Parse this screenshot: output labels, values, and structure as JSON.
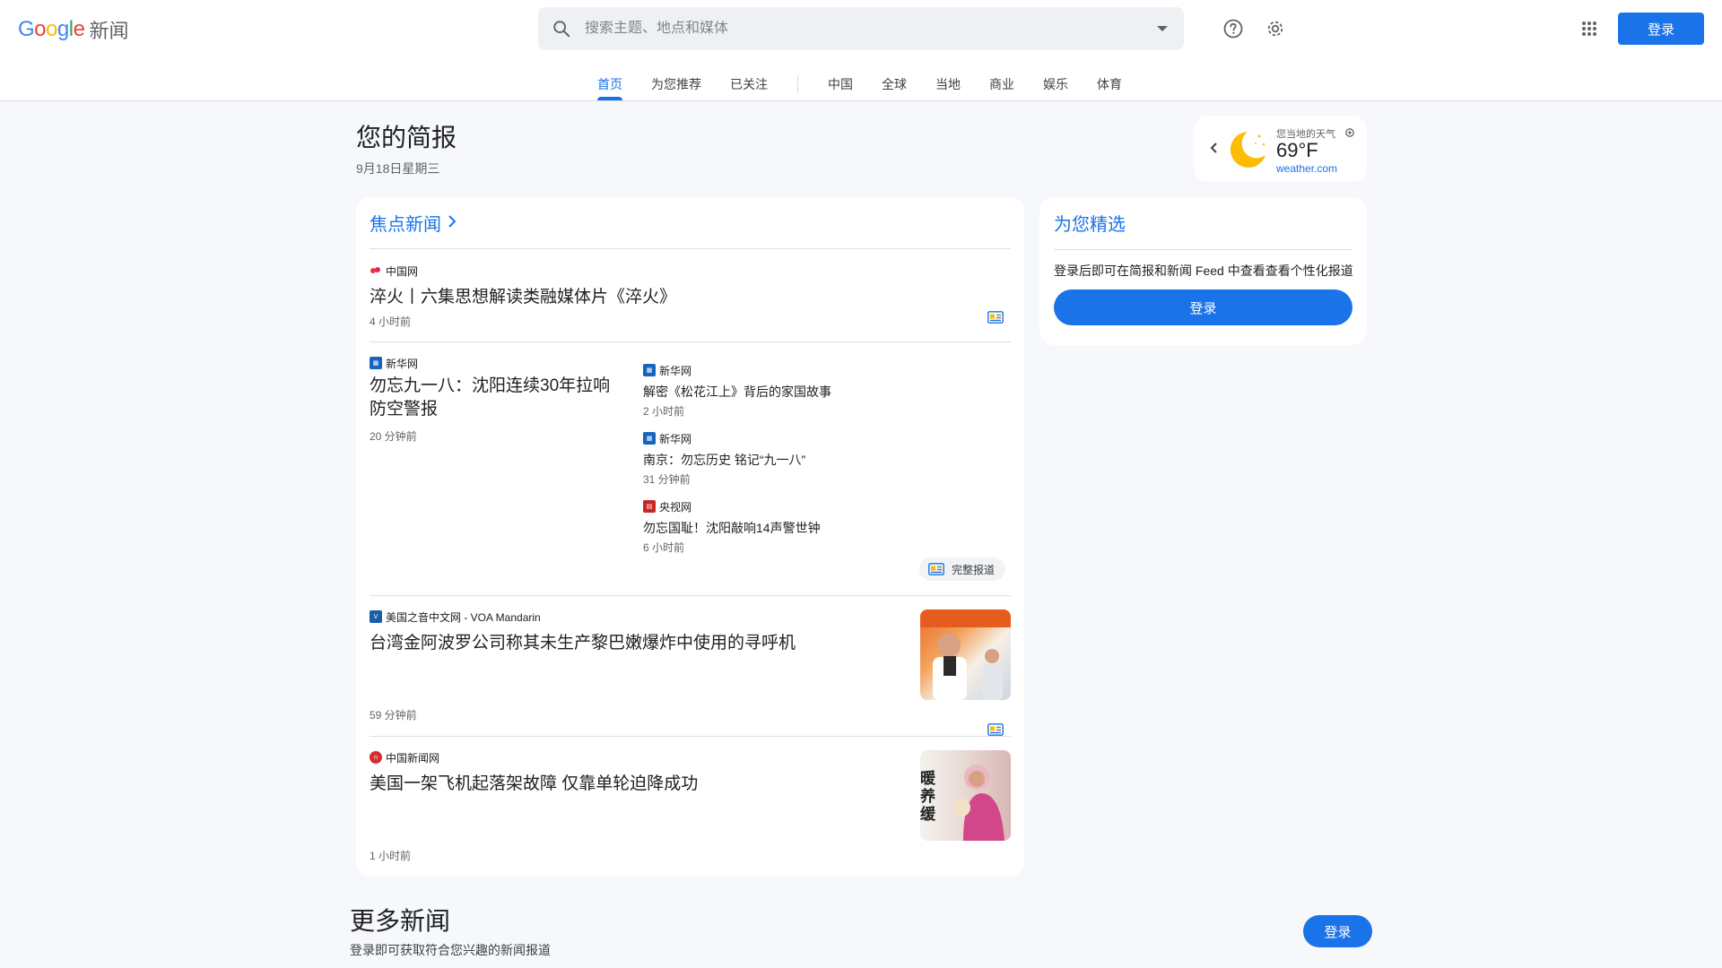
{
  "header": {
    "logo_text": "Google",
    "logo_suffix": "新闻",
    "search_placeholder": "搜索主题、地点和媒体",
    "login_label": "登录",
    "icons": [
      "search-icon",
      "dropdown-icon",
      "help-icon",
      "settings-icon",
      "apps-grid-icon"
    ]
  },
  "nav": {
    "tabs": [
      {
        "label": "首页",
        "active": true
      },
      {
        "label": "为您推荐"
      },
      {
        "label": "已关注"
      }
    ],
    "sections": [
      {
        "label": "中国"
      },
      {
        "label": "全球"
      },
      {
        "label": "当地"
      },
      {
        "label": "商业"
      },
      {
        "label": "娱乐"
      },
      {
        "label": "体育"
      }
    ]
  },
  "briefing": {
    "title": "您的简报",
    "date": "9月18日星期三"
  },
  "weather": {
    "label": "您当地的天气",
    "temp": "69°F",
    "source": "weather.com"
  },
  "top_stories": {
    "title": "焦点新闻",
    "stories": [
      {
        "source": "中国网",
        "headline": "淬火丨六集思想解读类融媒体片《淬火》",
        "time": "4 小时前"
      },
      {
        "source": "新华网",
        "headline": "勿忘九一八：沈阳连续30年拉响防空警报",
        "time": "20 分钟前"
      },
      {
        "source": "美国之音中文网 - VOA Mandarin",
        "headline": "台湾金阿波罗公司称其未生产黎巴嫩爆炸中使用的寻呼机",
        "time": "59 分钟前"
      },
      {
        "source": "中国新闻网",
        "headline": "美国一架飞机起落架故障 仅靠单轮迫降成功",
        "time": "1 小时前"
      }
    ],
    "related": [
      {
        "source": "新华网",
        "headline": "解密《松花江上》背后的家国故事",
        "time": "2 小时前"
      },
      {
        "source": "新华网",
        "headline": "南京：勿忘历史 铭记“九一八”",
        "time": "31 分钟前"
      },
      {
        "source": "央视网",
        "headline": "勿忘国耻！沈阳敲响14声警世钟",
        "time": "6 小时前"
      }
    ],
    "full_coverage_label": "完整报道",
    "thumb_text": "暖\n养\n缓"
  },
  "picks": {
    "title": "为您精选",
    "text": "登录后即可在简报和新闻 Feed 中查看查看个性化报道",
    "login_label": "登录"
  },
  "more": {
    "title": "更多新闻",
    "subtitle": "登录即可获取符合您兴趣的新闻报道",
    "login_label": "登录"
  },
  "colors": {
    "accent": "#1a73e8",
    "background": "#f6f8fc"
  }
}
